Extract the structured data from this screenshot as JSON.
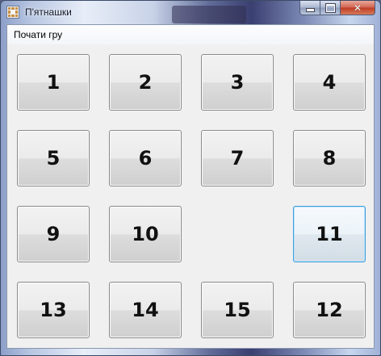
{
  "window": {
    "title": "П'ятнашки",
    "controls": {
      "minimize": "minimize",
      "maximize": "maximize",
      "close": "✕"
    }
  },
  "menu": {
    "new_game": "Почати гру"
  },
  "board": {
    "empty_cell": "row 3, column 3",
    "focused_tile": "11",
    "tiles": [
      "1",
      "2",
      "3",
      "4",
      "5",
      "6",
      "7",
      "8",
      "9",
      "10",
      "11",
      "13",
      "14",
      "15",
      "12"
    ]
  },
  "colors": {
    "focus_border": "#3c9ddc",
    "client_background": "#f0f0f0"
  }
}
